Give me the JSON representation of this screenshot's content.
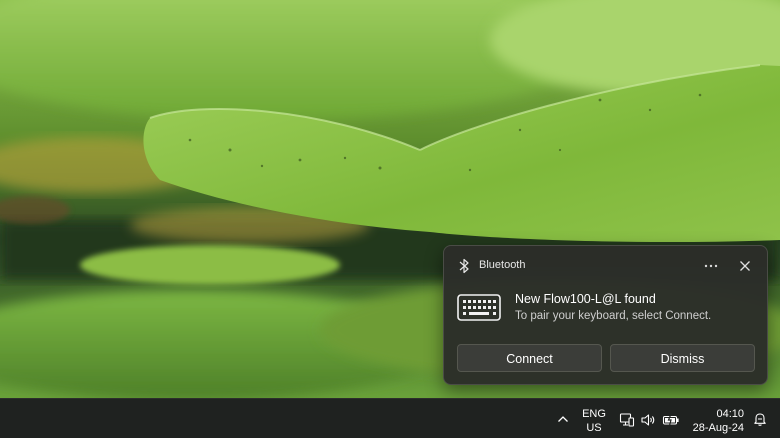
{
  "notification": {
    "app_name": "Bluetooth",
    "more_icon": "more-dots-icon",
    "close_icon": "close-icon",
    "device_icon": "keyboard-icon",
    "title": "New Flow100-L@L found",
    "body": "To pair your keyboard, select Connect.",
    "buttons": {
      "connect": "Connect",
      "dismiss": "Dismiss"
    }
  },
  "taskbar": {
    "language": {
      "line1": "ENG",
      "line2": "US"
    },
    "icons": [
      "chevron-up-icon",
      "network-icon",
      "volume-icon",
      "battery-icon",
      "notification-bell-icon"
    ],
    "clock": {
      "time": "04:10",
      "date": "28-Aug-24"
    }
  },
  "colors": {
    "toast_bg": "#2b2d29",
    "taskbar_bg": "#1f2220",
    "button_bg": "#3b3d39",
    "wallpaper_green": "#7fb83a"
  }
}
